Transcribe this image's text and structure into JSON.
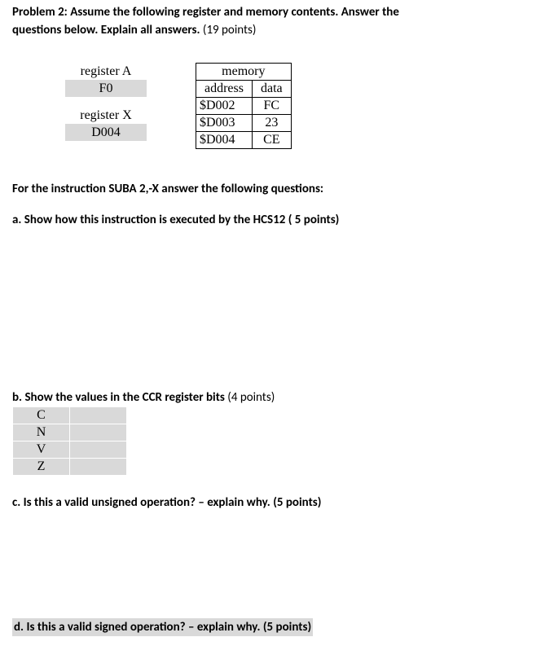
{
  "title_line1": "Problem 2:  Assume the following register and memory contents.  Answer the",
  "title_line2a": "questions below.   Explain all answers.   ",
  "title_line2b": "(19 points)",
  "regA_label": "register A",
  "regA_value": "F0",
  "regX_label": "register X",
  "regX_value": "D004",
  "mem_title": "memory",
  "mem_h1": "address",
  "mem_h2": "data",
  "mem_rows": [
    {
      "addr": "$D002",
      "data": "FC"
    },
    {
      "addr": "$D003",
      "data": "23"
    },
    {
      "addr": "$D004",
      "data": "CE"
    }
  ],
  "q_head": "For the instruction SUBA 2,-X answer the following questions:",
  "qa": "a. Show how this instruction is executed by the HCS12  ( 5 points)",
  "qb_text": "b. Show the values in the CCR register bits",
  "qb_points": "    (4 points)",
  "ccr": [
    "C",
    "N",
    "V",
    "Z"
  ],
  "qc": "c. Is  this  a valid unsigned operation? – explain why.  (5 points)",
  "qd": "d. Is  this  a valid signed operation? – explain why.  (5 points)"
}
